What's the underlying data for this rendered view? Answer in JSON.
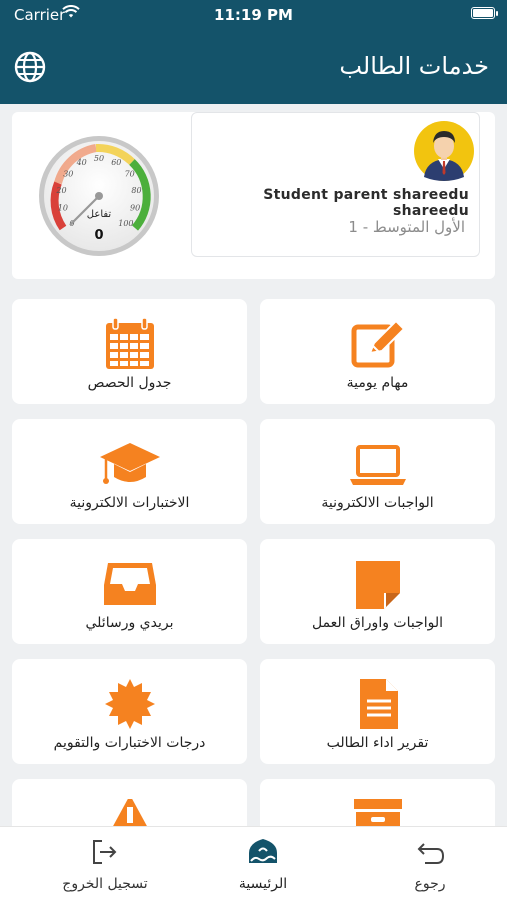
{
  "status_bar": {
    "carrier": "Carrier",
    "time": "11:19 PM"
  },
  "header": {
    "title": "خدمات الطالب"
  },
  "profile": {
    "student_name": "Student parent shareedu shareedu",
    "grade": "الأول المتوسط - 1",
    "gauge": {
      "label": "تفاعل",
      "value": "0",
      "ticks": [
        "0",
        "10",
        "20",
        "30",
        "40",
        "50",
        "60",
        "70",
        "80",
        "90",
        "100"
      ]
    }
  },
  "tiles": [
    {
      "label": "مهام يومية",
      "icon": "edit-icon"
    },
    {
      "label": "جدول الحصص",
      "icon": "calendar-icon"
    },
    {
      "label": "الواجبات الالكترونية",
      "icon": "laptop-icon"
    },
    {
      "label": "الاختبارات الالكترونية",
      "icon": "graduation-cap-icon"
    },
    {
      "label": "الواجبات واوراق العمل",
      "icon": "sticky-note-icon"
    },
    {
      "label": "بريدي ورسائلي",
      "icon": "inbox-icon"
    },
    {
      "label": "تقرير اداء الطالب",
      "icon": "document-icon"
    },
    {
      "label": "درجات الاختبارات والتقويم",
      "icon": "badge-icon"
    },
    {
      "label": "",
      "icon": "archive-icon"
    },
    {
      "label": "",
      "icon": "warning-icon"
    }
  ],
  "bottom_nav": {
    "logout": "تسجيل الخروج",
    "home": "الرئيسية",
    "back": "رجوع"
  },
  "colors": {
    "primary": "#14536a",
    "accent": "#f58220",
    "background": "#eef0f2"
  }
}
